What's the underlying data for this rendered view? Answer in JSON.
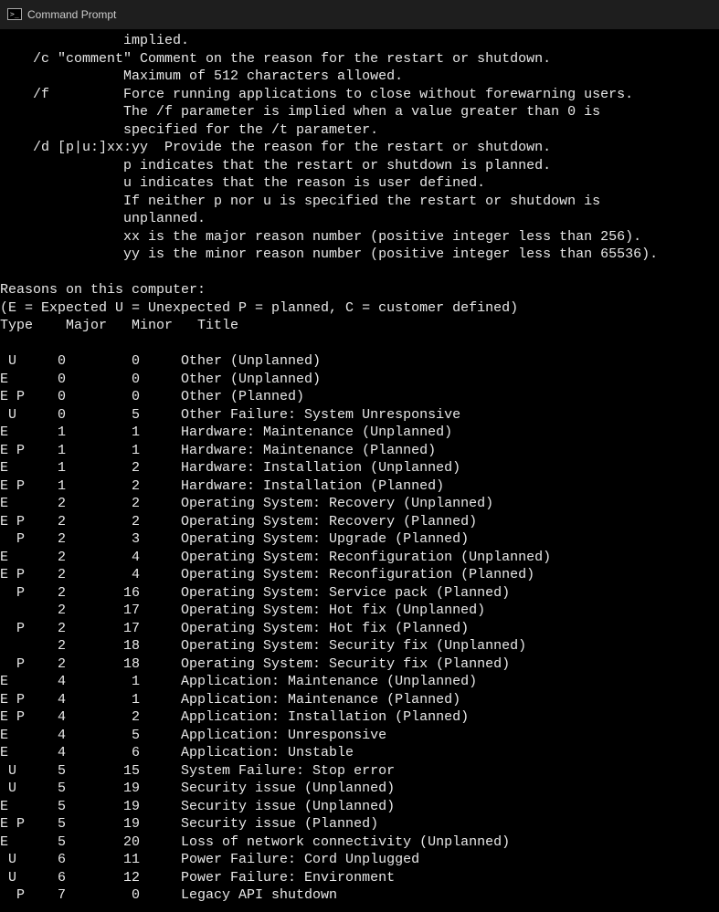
{
  "window": {
    "title": "Command Prompt"
  },
  "help": {
    "line_implied": "               implied.",
    "line_c1": "    /c \"comment\" Comment on the reason for the restart or shutdown.",
    "line_c2": "               Maximum of 512 characters allowed.",
    "line_f1": "    /f         Force running applications to close without forewarning users.",
    "line_f2": "               The /f parameter is implied when a value greater than 0 is",
    "line_f3": "               specified for the /t parameter.",
    "line_d1": "    /d [p|u:]xx:yy  Provide the reason for the restart or shutdown.",
    "line_d2": "               p indicates that the restart or shutdown is planned.",
    "line_d3": "               u indicates that the reason is user defined.",
    "line_d4": "               If neither p nor u is specified the restart or shutdown is",
    "line_d5": "               unplanned.",
    "line_d6": "               xx is the major reason number (positive integer less than 256).",
    "line_d7": "               yy is the minor reason number (positive integer less than 65536)."
  },
  "reasons_header": {
    "l1": "Reasons on this computer:",
    "l2": "(E = Expected U = Unexpected P = planned, C = customer defined)",
    "l3": "Type    Major   Minor   Title"
  },
  "rows": [
    {
      "type": " U ",
      "major": 0,
      "minor": 0,
      "title": "Other (Unplanned)"
    },
    {
      "type": "E  ",
      "major": 0,
      "minor": 0,
      "title": "Other (Unplanned)"
    },
    {
      "type": "E P",
      "major": 0,
      "minor": 0,
      "title": "Other (Planned)"
    },
    {
      "type": " U ",
      "major": 0,
      "minor": 5,
      "title": "Other Failure: System Unresponsive"
    },
    {
      "type": "E  ",
      "major": 1,
      "minor": 1,
      "title": "Hardware: Maintenance (Unplanned)"
    },
    {
      "type": "E P",
      "major": 1,
      "minor": 1,
      "title": "Hardware: Maintenance (Planned)"
    },
    {
      "type": "E  ",
      "major": 1,
      "minor": 2,
      "title": "Hardware: Installation (Unplanned)"
    },
    {
      "type": "E P",
      "major": 1,
      "minor": 2,
      "title": "Hardware: Installation (Planned)"
    },
    {
      "type": "E  ",
      "major": 2,
      "minor": 2,
      "title": "Operating System: Recovery (Unplanned)"
    },
    {
      "type": "E P",
      "major": 2,
      "minor": 2,
      "title": "Operating System: Recovery (Planned)"
    },
    {
      "type": "  P",
      "major": 2,
      "minor": 3,
      "title": "Operating System: Upgrade (Planned)"
    },
    {
      "type": "E  ",
      "major": 2,
      "minor": 4,
      "title": "Operating System: Reconfiguration (Unplanned)"
    },
    {
      "type": "E P",
      "major": 2,
      "minor": 4,
      "title": "Operating System: Reconfiguration (Planned)"
    },
    {
      "type": "  P",
      "major": 2,
      "minor": 16,
      "title": "Operating System: Service pack (Planned)"
    },
    {
      "type": "   ",
      "major": 2,
      "minor": 17,
      "title": "Operating System: Hot fix (Unplanned)"
    },
    {
      "type": "  P",
      "major": 2,
      "minor": 17,
      "title": "Operating System: Hot fix (Planned)"
    },
    {
      "type": "   ",
      "major": 2,
      "minor": 18,
      "title": "Operating System: Security fix (Unplanned)"
    },
    {
      "type": "  P",
      "major": 2,
      "minor": 18,
      "title": "Operating System: Security fix (Planned)"
    },
    {
      "type": "E  ",
      "major": 4,
      "minor": 1,
      "title": "Application: Maintenance (Unplanned)"
    },
    {
      "type": "E P",
      "major": 4,
      "minor": 1,
      "title": "Application: Maintenance (Planned)"
    },
    {
      "type": "E P",
      "major": 4,
      "minor": 2,
      "title": "Application: Installation (Planned)"
    },
    {
      "type": "E  ",
      "major": 4,
      "minor": 5,
      "title": "Application: Unresponsive"
    },
    {
      "type": "E  ",
      "major": 4,
      "minor": 6,
      "title": "Application: Unstable"
    },
    {
      "type": " U ",
      "major": 5,
      "minor": 15,
      "title": "System Failure: Stop error"
    },
    {
      "type": " U ",
      "major": 5,
      "minor": 19,
      "title": "Security issue (Unplanned)"
    },
    {
      "type": "E  ",
      "major": 5,
      "minor": 19,
      "title": "Security issue (Unplanned)"
    },
    {
      "type": "E P",
      "major": 5,
      "minor": 19,
      "title": "Security issue (Planned)"
    },
    {
      "type": "E  ",
      "major": 5,
      "minor": 20,
      "title": "Loss of network connectivity (Unplanned)"
    },
    {
      "type": " U ",
      "major": 6,
      "minor": 11,
      "title": "Power Failure: Cord Unplugged"
    },
    {
      "type": " U ",
      "major": 6,
      "minor": 12,
      "title": "Power Failure: Environment"
    },
    {
      "type": "  P",
      "major": 7,
      "minor": 0,
      "title": "Legacy API shutdown"
    }
  ]
}
